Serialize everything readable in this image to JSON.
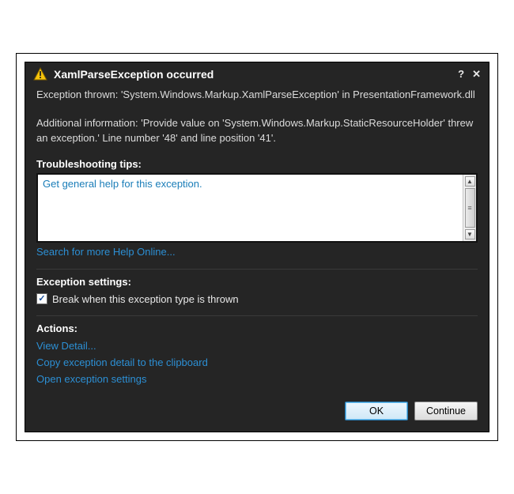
{
  "titlebar": {
    "title": "XamlParseException occurred",
    "help_symbol": "?",
    "close_symbol": "✕"
  },
  "message": {
    "line1": "Exception thrown: 'System.Windows.Markup.XamlParseException' in PresentationFramework.dll",
    "line2": "Additional information: 'Provide value on 'System.Windows.Markup.StaticResourceHolder' threw an exception.' Line number '48' and line position '41'."
  },
  "troubleshooting": {
    "heading": "Troubleshooting tips:",
    "general_help_link": "Get general help for this exception.",
    "search_online_link": "Search for more Help Online..."
  },
  "exception_settings": {
    "heading": "Exception settings:",
    "break_checkbox_label": "Break when this exception type is thrown",
    "break_checked": true
  },
  "actions": {
    "heading": "Actions:",
    "view_detail": "View Detail...",
    "copy_clipboard": "Copy exception detail to the clipboard",
    "open_settings": "Open exception settings"
  },
  "buttons": {
    "ok": "OK",
    "continue": "Continue"
  }
}
